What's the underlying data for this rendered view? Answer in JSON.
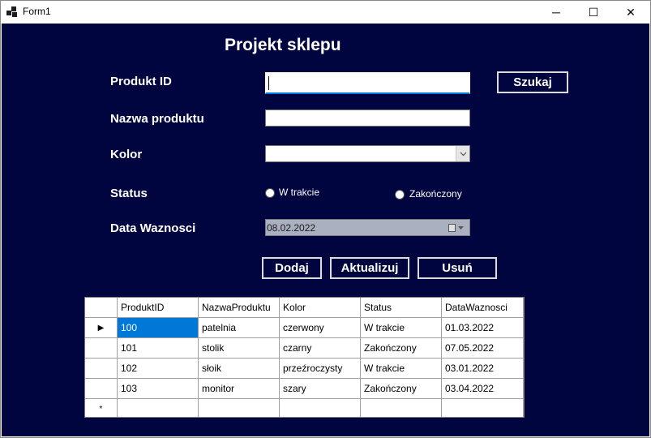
{
  "window": {
    "title": "Form1",
    "minimize_glyph": "─",
    "maximize_glyph": "☐",
    "close_glyph": "✕"
  },
  "form": {
    "heading": "Projekt sklepu",
    "labels": {
      "produkt_id": "Produkt ID",
      "nazwa": "Nazwa produktu",
      "kolor": "Kolor",
      "status": "Status",
      "data": "Data Waznosci"
    },
    "produkt_id_value": "",
    "nazwa_value": "",
    "kolor_value": "",
    "status_options": [
      "W trakcie",
      "Zakończony"
    ],
    "date_value": "08.02.2022",
    "buttons": {
      "szukaj": "Szukaj",
      "dodaj": "Dodaj",
      "aktualizuj": "Aktualizuj",
      "usun": "Usuń"
    }
  },
  "grid": {
    "columns": [
      "ProduktID",
      "NazwaProduktu",
      "Kolor",
      "Status",
      "DataWaznosci"
    ],
    "rows": [
      [
        "100",
        "patelnia",
        "czerwony",
        "W trakcie",
        "01.03.2022"
      ],
      [
        "101",
        "stolik",
        "czarny",
        "Zakończony",
        "07.05.2022"
      ],
      [
        "102",
        "słoik",
        "przeźroczysty",
        "W trakcie",
        "03.01.2022"
      ],
      [
        "103",
        "monitor",
        "szary",
        "Zakończony",
        "03.04.2022"
      ]
    ],
    "current_row_marker": "▶",
    "new_row_marker": "*"
  },
  "colors": {
    "form_background": "#01053f",
    "selection": "#0078d7"
  }
}
